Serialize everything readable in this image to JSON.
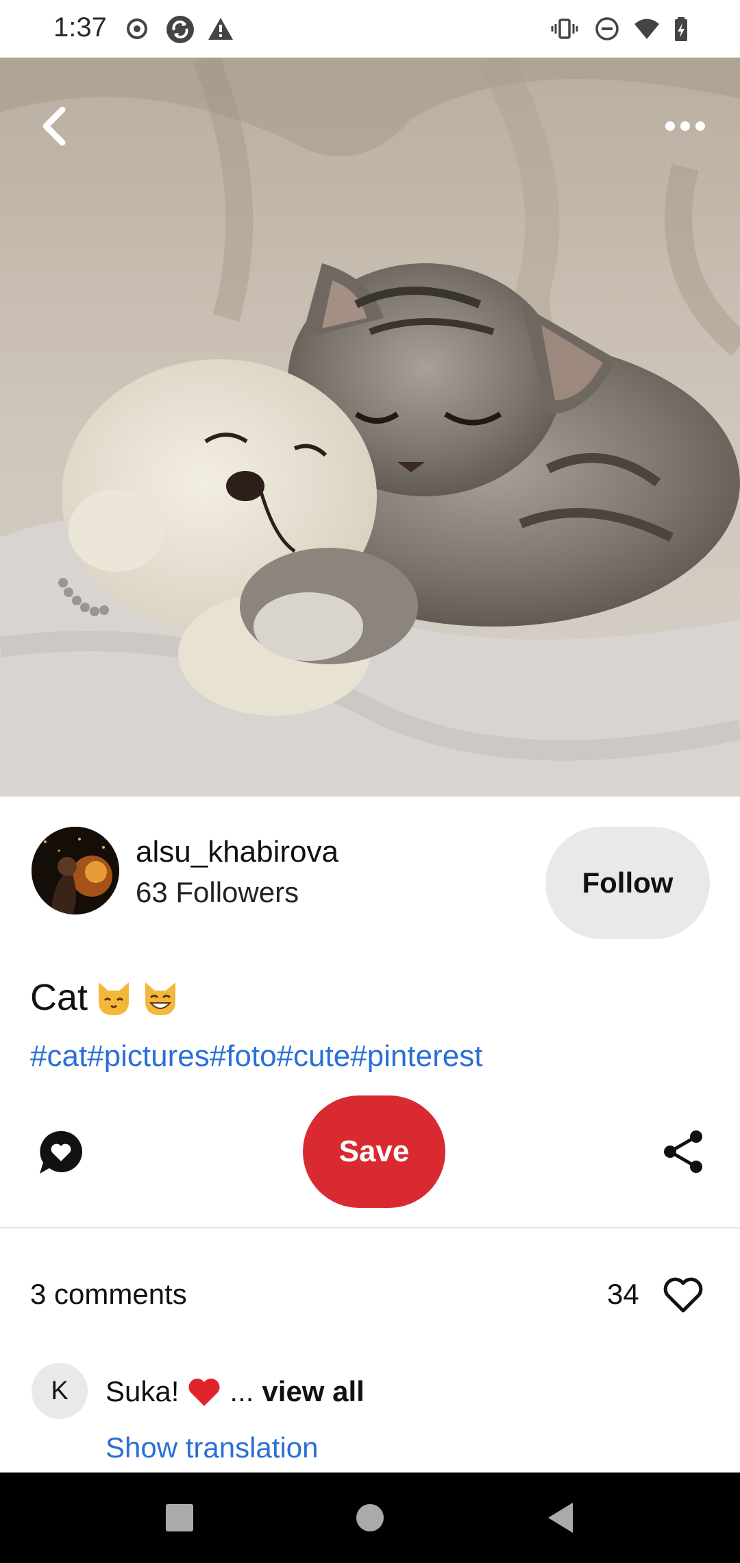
{
  "status_bar": {
    "time": "1:37",
    "left_icons": [
      "record-icon",
      "sync-icon",
      "warning-icon"
    ],
    "right_icons": [
      "vibrate-icon",
      "dnd-icon",
      "wifi-icon",
      "battery-icon"
    ]
  },
  "hero": {
    "back_icon": "chevron-left-icon",
    "more_icon": "more-horizontal-icon"
  },
  "creator": {
    "name": "alsu_khabirova",
    "followers": "63 Followers",
    "follow_label": "Follow"
  },
  "pin": {
    "title": "Cat",
    "title_emojis": [
      "cat-face-emoji",
      "grinning-cat-emoji"
    ],
    "hashtags": "#cat#pictures#foto#cute#pinterest"
  },
  "actions": {
    "save_label": "Save",
    "comment_icon": "comment-icon",
    "share_icon": "share-icon"
  },
  "comments": {
    "count_label": "3 comments",
    "likes": "34",
    "first": {
      "avatar_initial": "K",
      "text": "Suka!",
      "ellipsis": "...",
      "view_all_label": "view all",
      "show_translation_label": "Show translation"
    }
  },
  "colors": {
    "accent_red": "#d92a32",
    "link_blue": "#2a6fd6",
    "follow_bg": "#e9e9e9"
  }
}
